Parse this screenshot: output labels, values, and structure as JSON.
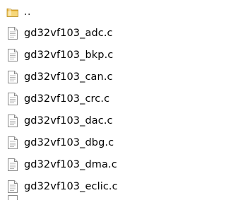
{
  "file_list": {
    "parent": {
      "label": "..",
      "icon": "folder-icon"
    },
    "files": [
      {
        "name": "gd32vf103_adc.c",
        "icon": "c-file-icon"
      },
      {
        "name": "gd32vf103_bkp.c",
        "icon": "c-file-icon"
      },
      {
        "name": "gd32vf103_can.c",
        "icon": "c-file-icon"
      },
      {
        "name": "gd32vf103_crc.c",
        "icon": "c-file-icon"
      },
      {
        "name": "gd32vf103_dac.c",
        "icon": "c-file-icon"
      },
      {
        "name": "gd32vf103_dbg.c",
        "icon": "c-file-icon"
      },
      {
        "name": "gd32vf103_dma.c",
        "icon": "c-file-icon"
      },
      {
        "name": "gd32vf103_eclic.c",
        "icon": "c-file-icon"
      }
    ]
  },
  "colors": {
    "folder": "#e8b33a",
    "folder_light": "#f6d77a",
    "file_border": "#8a8a8a",
    "file_lines": "#b5b5b5"
  }
}
